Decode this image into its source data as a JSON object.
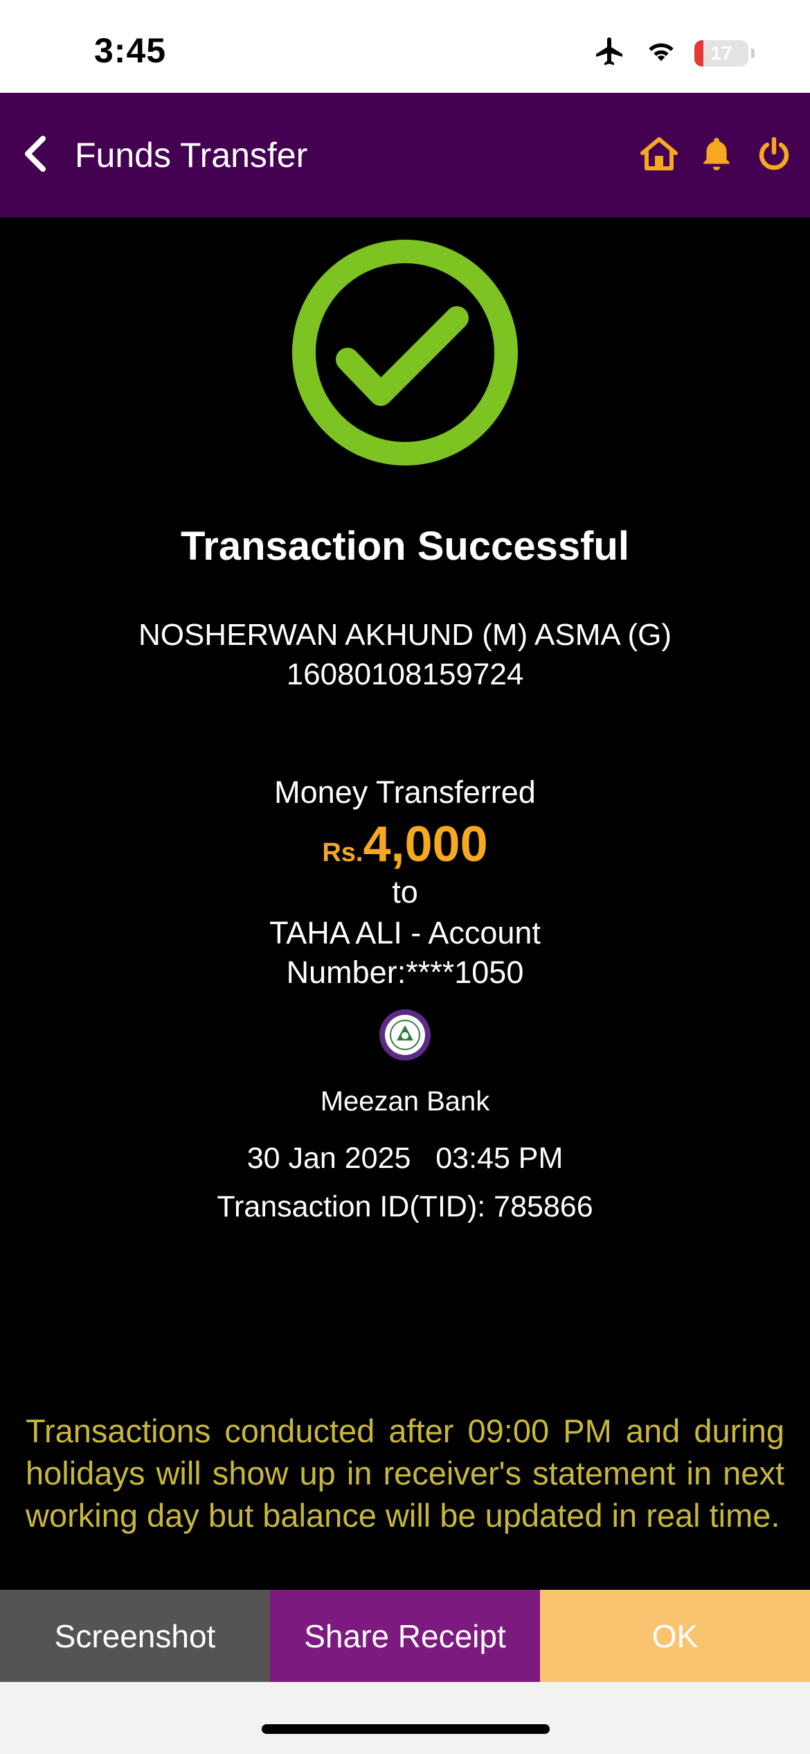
{
  "status_bar": {
    "time": "3:45",
    "battery_level": "17",
    "icons": [
      "airplane-icon",
      "wifi-icon",
      "battery-icon"
    ]
  },
  "header": {
    "title": "Funds Transfer",
    "icons": [
      "back-icon",
      "home-icon",
      "bell-icon",
      "power-icon"
    ],
    "background_color": "#440152",
    "icon_color": "#f6a91f"
  },
  "receipt": {
    "title": "Transaction Successful",
    "sender_name": "NOSHERWAN AKHUND (M) ASMA (G)",
    "sender_account": "16080108159724",
    "money_label": "Money Transferred",
    "currency": "Rs.",
    "amount": "4,000",
    "to_label": "to",
    "beneficiary": "TAHA ALI  - Account Number:****1050",
    "bank_name": "Meezan Bank",
    "date": "30 Jan 2025",
    "time": "03:45 PM",
    "transaction_id": "Transaction ID(TID): 785866",
    "success_color": "#7dc321",
    "amount_color": "#f6a91f"
  },
  "notice": "Transactions conducted after 09:00 PM and during holidays will show up in receiver's statement in next working day but balance will be updated in real time.",
  "actions": {
    "screenshot_label": "Screenshot",
    "share_label": "Share Receipt",
    "ok_label": "OK"
  }
}
